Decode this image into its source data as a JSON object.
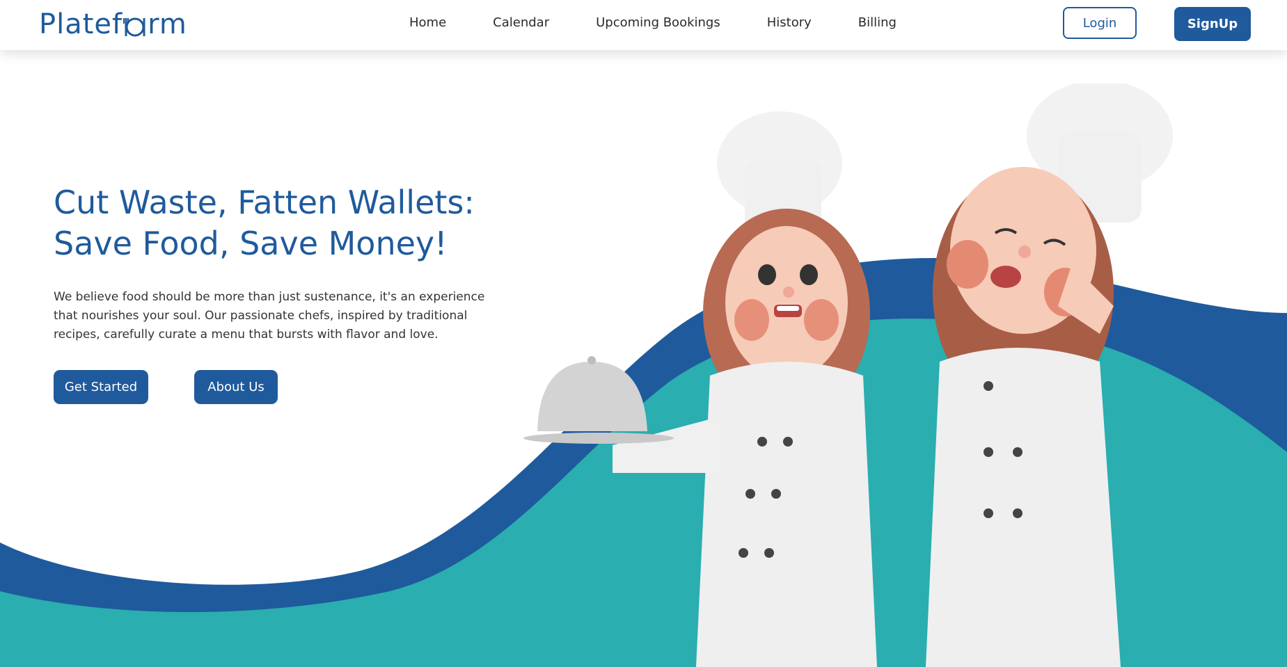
{
  "header": {
    "logo_text_start": "Platef",
    "logo_text_end": "rm",
    "nav": [
      {
        "label": "Home"
      },
      {
        "label": "Calendar"
      },
      {
        "label": "Upcoming Bookings"
      },
      {
        "label": "History"
      },
      {
        "label": "Billing"
      }
    ],
    "login_label": "Login",
    "signup_label": "SignUp"
  },
  "hero": {
    "title_line1": "Cut Waste, Fatten Wallets:",
    "title_line2": "Save Food, Save Money!",
    "description": "We believe food should be more than just sustenance, it's an experience that nourishes your soul. Our passionate chefs, inspired by traditional recipes, carefully curate a menu that bursts with flavor and love.",
    "get_started_label": "Get Started",
    "about_label": "About Us"
  },
  "colors": {
    "primary": "#1f5a9c",
    "teal": "#2aaeb0",
    "text": "#333333",
    "background": "#ffffff"
  },
  "icons": [
    "fork-knife-icon",
    "cloche-icon"
  ]
}
